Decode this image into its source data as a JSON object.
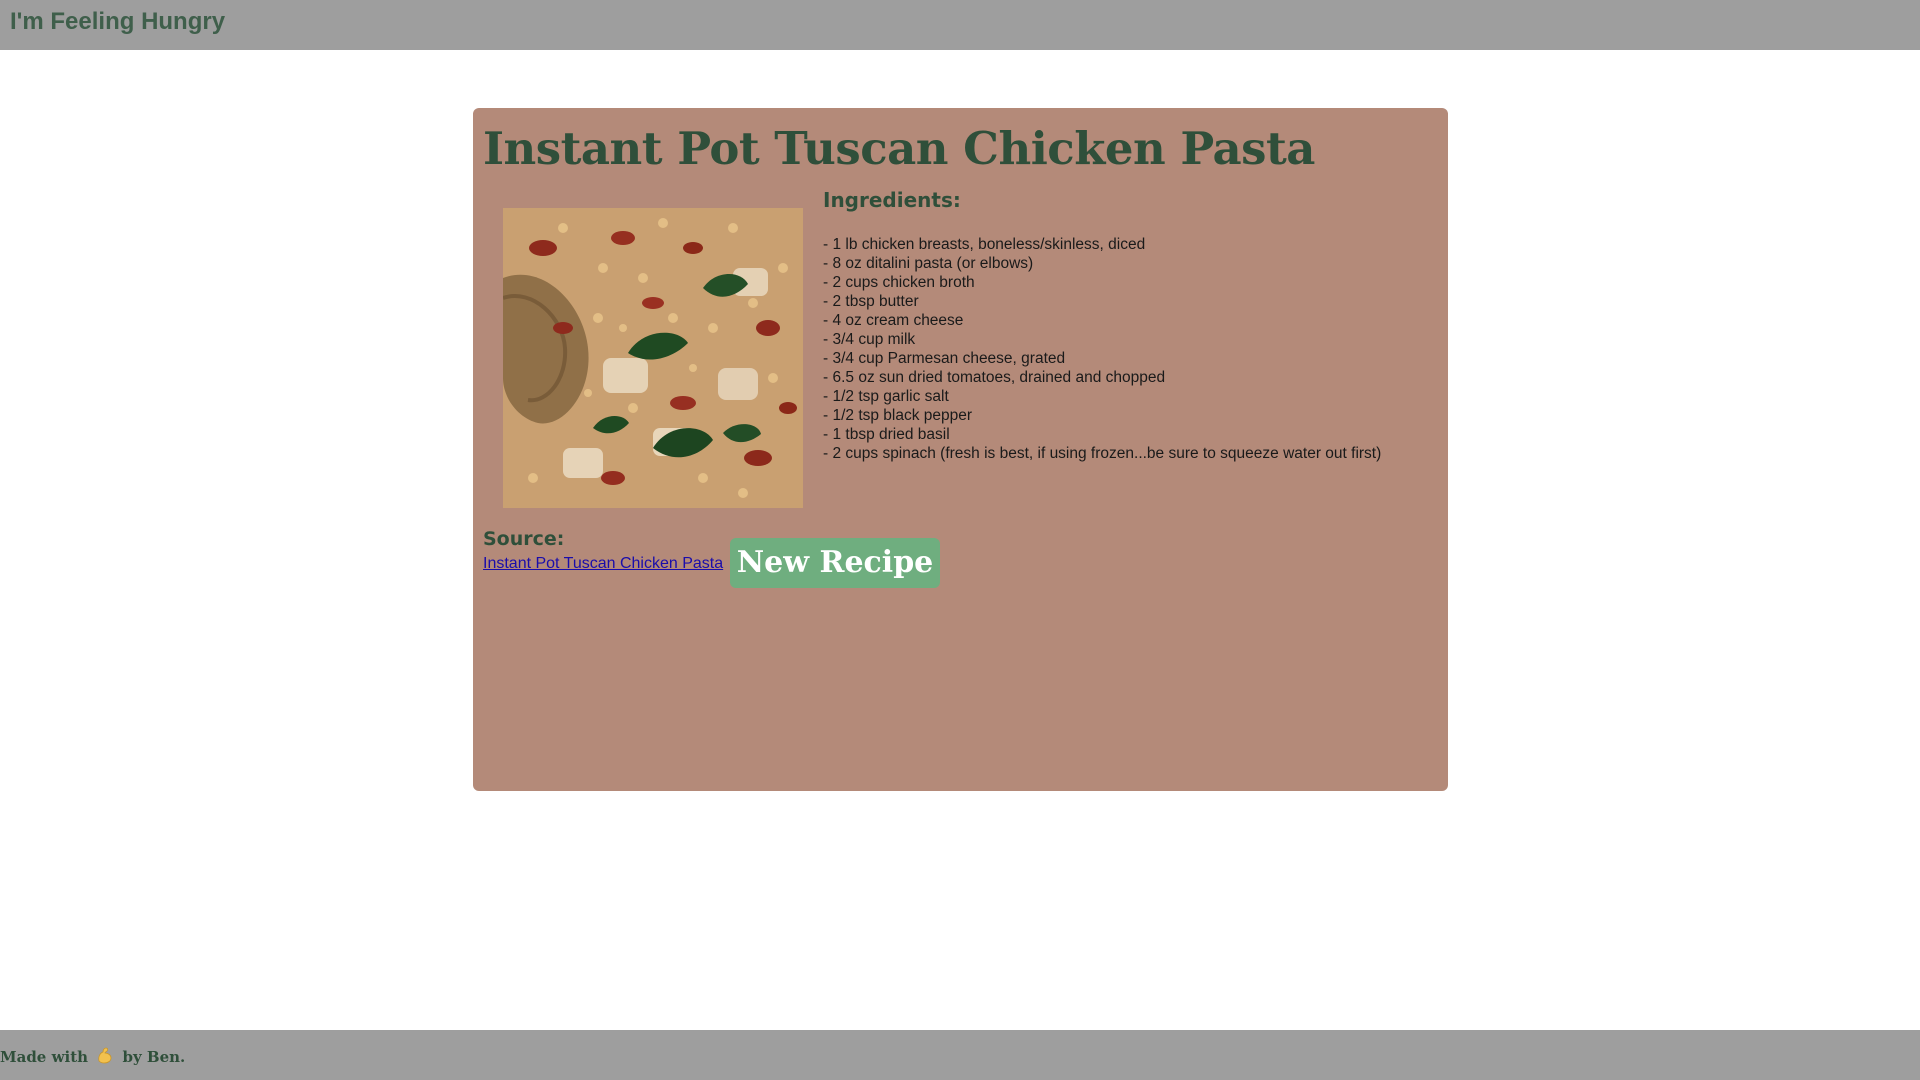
{
  "header": {
    "site_title": "I'm Feeling Hungry"
  },
  "recipe": {
    "title": "Instant Pot Tuscan Chicken Pasta",
    "image_icon": "recipe-photo",
    "ingredients_heading": "Ingredients:",
    "ingredients": [
      "- 1 lb chicken breasts, boneless/skinless, diced",
      "- 8 oz ditalini pasta (or elbows)",
      "- 2 cups chicken broth",
      "- 2 tbsp butter",
      "- 4 oz cream cheese",
      "- 3/4 cup milk",
      "- 3/4 cup Parmesan cheese, grated",
      "- 6.5 oz sun dried tomatoes, drained and chopped",
      "- 1/2 tsp garlic salt",
      "- 1/2 tsp black pepper",
      "- 1 tbsp dried basil",
      "- 2 cups spinach (fresh is best, if using frozen...be sure to squeeze water out first)"
    ],
    "source_heading": "Source:",
    "source_link_text": "Instant Pot Tuscan Chicken Pasta",
    "new_recipe_label": "New Recipe"
  },
  "footer": {
    "made_with": "Made with",
    "by": "by Ben.",
    "icon": "flexed-biceps-icon"
  },
  "colors": {
    "bar_gray": "#9e9e9e",
    "card_bg": "#b48a79",
    "title_green": "#2f4f3a",
    "button_green": "#6fae7f"
  }
}
